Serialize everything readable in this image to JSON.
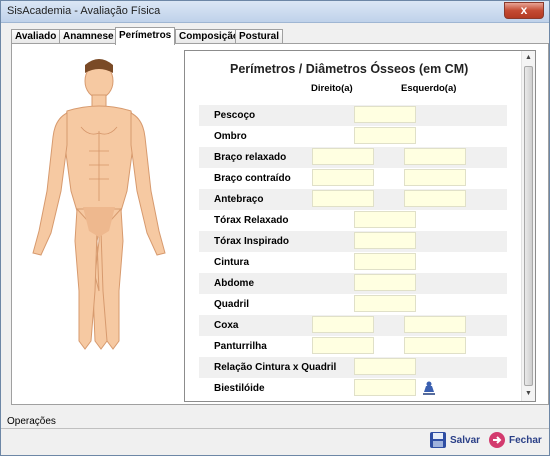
{
  "window": {
    "title": "SisAcademia - Avaliação Física",
    "close_label": "x"
  },
  "tabs": [
    {
      "label": "Avaliado"
    },
    {
      "label": "Anamnese"
    },
    {
      "label": "Perímetros",
      "active": true
    },
    {
      "label": "Composição"
    },
    {
      "label": "Postural"
    }
  ],
  "form": {
    "title": "Perímetros / Diâmetros Ósseos (em CM)",
    "col_right": "Direito(a)",
    "col_left": "Esquerdo(a)",
    "rows": [
      {
        "label": "Pescoço"
      },
      {
        "label": "Ombro"
      },
      {
        "label": "Braço relaxado"
      },
      {
        "label": "Braço contraído"
      },
      {
        "label": "Antebraço"
      },
      {
        "label": "Tórax Relaxado"
      },
      {
        "label": "Tórax Inspirado"
      },
      {
        "label": "Cintura"
      },
      {
        "label": "Abdome"
      },
      {
        "label": "Quadril"
      },
      {
        "label": "Coxa"
      },
      {
        "label": "Panturrilha"
      },
      {
        "label": "Relação Cintura x Quadril"
      },
      {
        "label": "Biestilóide"
      }
    ]
  },
  "footer": {
    "operations_label": "Operações",
    "save_label": "Salvar",
    "close_label": "Fechar"
  },
  "colors": {
    "field_bg": "#ffffe1",
    "button_text": "#2a3f87",
    "close_red": "#c44b33"
  }
}
